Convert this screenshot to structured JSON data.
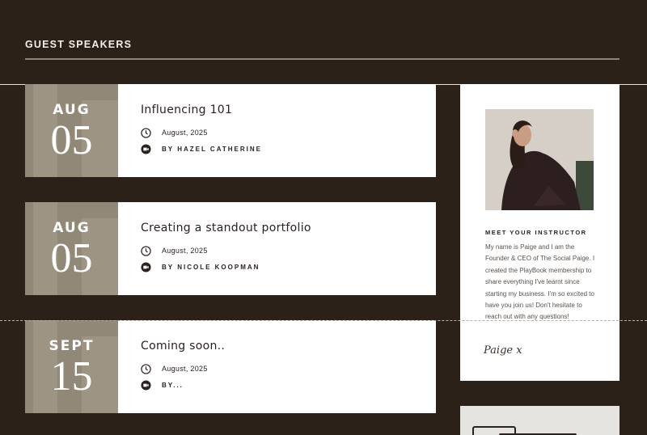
{
  "header": {
    "title": "GUEST SPEAKERS"
  },
  "events": [
    {
      "month": "AUG",
      "day": "05",
      "title": "Influencing 101",
      "date": "August, 2025",
      "by": "BY HAZEL CATHERINE"
    },
    {
      "month": "AUG",
      "day": "05",
      "title": "Creating a standout portfolio",
      "date": "August, 2025",
      "by": "BY NICOLE KOOPMAN"
    },
    {
      "month": "SEPT",
      "day": "15",
      "title": "Coming soon..",
      "date": "August, 2025",
      "by": "BY..."
    }
  ],
  "instructor": {
    "heading": "MEET YOUR INSTRUCTOR",
    "bio": "My name is Paige and I am the Founder & CEO of The Social Paige. I created the PlayBook membership to share everything I've learnt since starting my business. I'm so excited to have you join us! Don't hesitate to reach out with any questions!",
    "signature": "Paige x"
  },
  "icons": {
    "date": "clock-icon",
    "author": "video-camera-icon"
  },
  "colors": {
    "background": "#2c2119",
    "date_block": "#928877",
    "card": "#ffffff"
  }
}
